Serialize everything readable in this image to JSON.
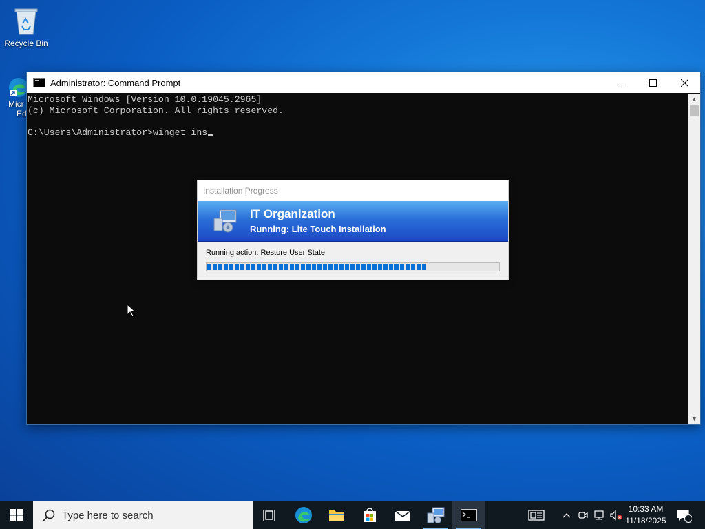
{
  "desktop": {
    "recycle_bin_label": "Recycle Bin",
    "edge_label_line1": "Micr",
    "edge_label_line2": "Ed"
  },
  "cmd_window": {
    "title": "Administrator: Command Prompt",
    "buttons": {
      "minimize": "—",
      "maximize": "☐",
      "close": "✕"
    },
    "lines": [
      "Microsoft Windows [Version 10.0.19045.2965]",
      "(c) Microsoft Corporation. All rights reserved.",
      "",
      "C:\\Users\\Administrator>winget ins"
    ]
  },
  "install_dialog": {
    "title": "Installation Progress",
    "organization": "IT Organization",
    "status": "Running: Lite Touch Installation",
    "action": "Running action: Restore User State",
    "progress_fraction": 0.75
  },
  "taskbar": {
    "search_placeholder": "Type here to search",
    "clock_time": "10:33 AM",
    "clock_date": "11/18/2025",
    "notification_count": "1"
  },
  "colors": {
    "desktop_blue": "#0a5cc2",
    "taskbar": "#101820",
    "banner_blue": "#2a6fd9",
    "progress_blue": "#0a6fd6"
  }
}
